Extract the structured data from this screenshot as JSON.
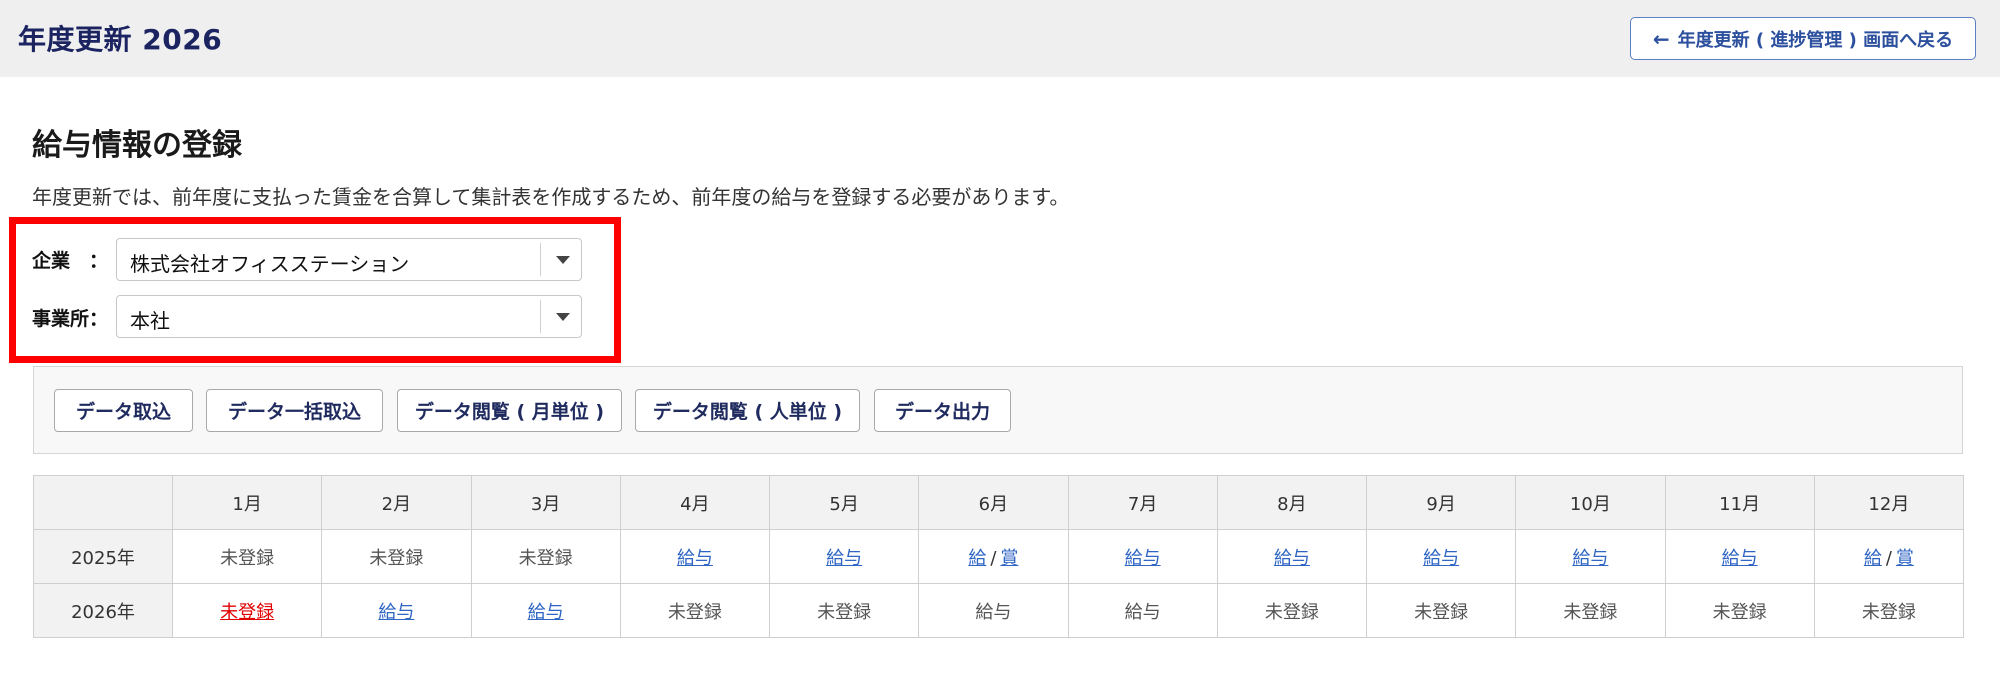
{
  "header": {
    "app_title": "年度更新 2026",
    "back_button_label": "年度更新 ( 進捗管理 ) 画面へ戻る",
    "back_icon": "arrow-left-icon"
  },
  "main": {
    "page_title": "給与情報の登録",
    "description": "年度更新では、前年度に支払った賃金を合算して集計表を作成するため、前年度の給与を登録する必要があります。"
  },
  "filters": {
    "company_label": "企業　：",
    "company_value": "株式会社オフィスステーション",
    "office_label": "事業所：",
    "office_value": "本社"
  },
  "toolbar": {
    "buttons": [
      "データ取込",
      "データ一括取込",
      "データ閲覧 ( 月単位 )",
      "データ閲覧 ( 人単位 )",
      "データ出力"
    ]
  },
  "table": {
    "months": [
      "1月",
      "2月",
      "3月",
      "4月",
      "5月",
      "6月",
      "7月",
      "8月",
      "9月",
      "10月",
      "11月",
      "12月"
    ],
    "rows": [
      {
        "year": "2025年",
        "cells": [
          {
            "text": "未登録",
            "kind": "unregistered"
          },
          {
            "text": "未登録",
            "kind": "unregistered"
          },
          {
            "text": "未登録",
            "kind": "unregistered"
          },
          {
            "text": "給与",
            "kind": "link"
          },
          {
            "text": "給与",
            "kind": "link"
          },
          {
            "text": "給",
            "text2": "賞",
            "sep": "/",
            "kind": "split-link"
          },
          {
            "text": "給与",
            "kind": "link"
          },
          {
            "text": "給与",
            "kind": "link"
          },
          {
            "text": "給与",
            "kind": "link"
          },
          {
            "text": "給与",
            "kind": "link"
          },
          {
            "text": "給与",
            "kind": "link"
          },
          {
            "text": "給",
            "text2": "賞",
            "sep": "/",
            "kind": "split-link"
          }
        ]
      },
      {
        "year": "2026年",
        "cells": [
          {
            "text": "未登録",
            "kind": "alert"
          },
          {
            "text": "給与",
            "kind": "link"
          },
          {
            "text": "給与",
            "kind": "link"
          },
          {
            "text": "未登録",
            "kind": "unregistered"
          },
          {
            "text": "未登録",
            "kind": "unregistered"
          },
          {
            "text": "給与",
            "kind": "plain"
          },
          {
            "text": "給与",
            "kind": "plain"
          },
          {
            "text": "未登録",
            "kind": "unregistered"
          },
          {
            "text": "未登録",
            "kind": "unregistered"
          },
          {
            "text": "未登録",
            "kind": "unregistered"
          },
          {
            "text": "未登録",
            "kind": "unregistered"
          },
          {
            "text": "未登録",
            "kind": "unregistered"
          }
        ]
      }
    ]
  },
  "colors": {
    "title": "#1b2460",
    "link": "#2f66c4",
    "alert": "#e00000",
    "highlight": "#ff0000"
  }
}
